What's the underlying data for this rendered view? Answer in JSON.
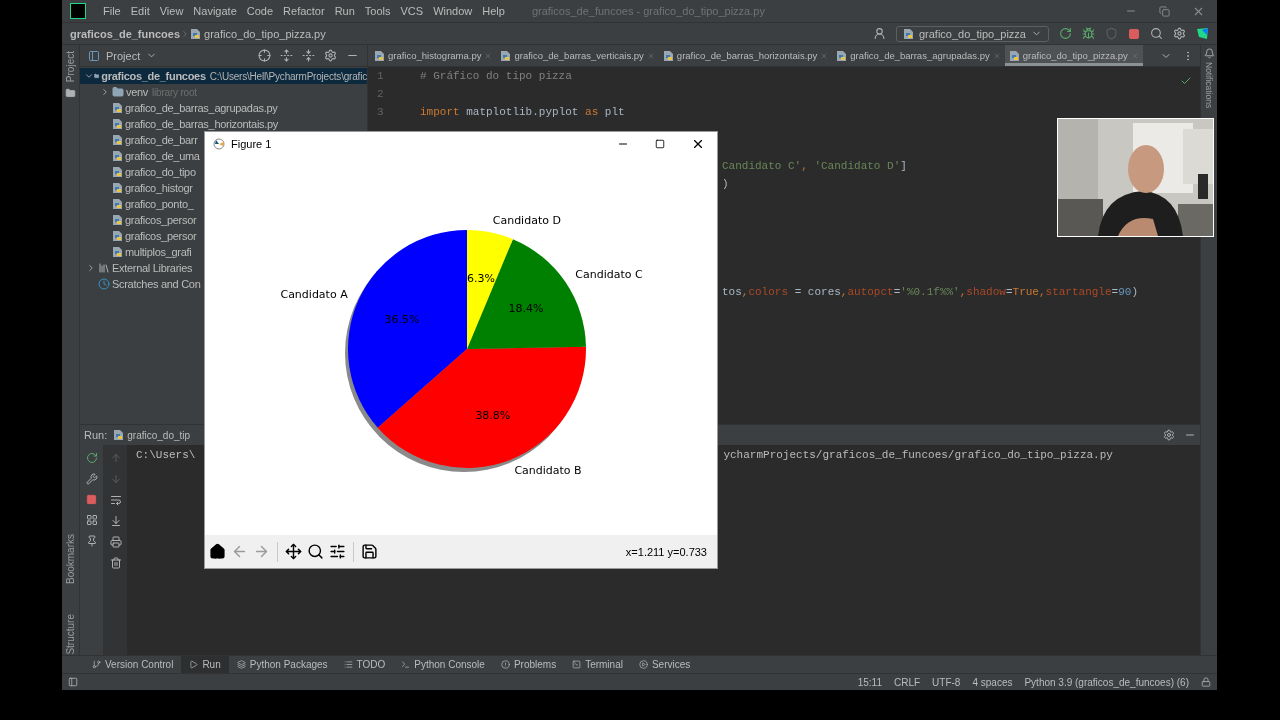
{
  "menu_bar": {
    "items": [
      "File",
      "Edit",
      "View",
      "Navigate",
      "Code",
      "Refactor",
      "Run",
      "Tools",
      "VCS",
      "Window",
      "Help"
    ],
    "title": "graficos_de_funcoes - grafico_do_tipo_pizza.py"
  },
  "nav_bar": {
    "breadcrumb": [
      "graficos_de_funcoes",
      "grafico_do_tipo_pizza.py"
    ],
    "run_config": "grafico_do_tipo_pizza"
  },
  "left_strip": [
    "Project",
    "Bookmarks",
    "Structure"
  ],
  "right_strip": "Notifications",
  "project_panel": {
    "title": "Project",
    "tree": [
      {
        "label": "graficos_de_funcoes",
        "path": "C:\\Users\\Hell\\PycharmProjects\\grafic",
        "kind": "folder",
        "expanded": true,
        "selected": true,
        "children": [
          {
            "label": "venv",
            "note": "library root",
            "kind": "folder",
            "expanded": false,
            "selected": false
          },
          {
            "label": "grafico_de_barras_agrupadas.py",
            "kind": "file",
            "selected": false
          },
          {
            "label": "grafico_de_barras_horizontais.py",
            "kind": "file",
            "selected": false
          },
          {
            "label": "grafico_de_barr",
            "kind": "file",
            "selected": false
          },
          {
            "label": "grafico_de_uma",
            "kind": "file",
            "selected": false
          },
          {
            "label": "grafico_do_tipo",
            "kind": "file",
            "selected": false
          },
          {
            "label": "grafico_histogr",
            "kind": "file",
            "selected": false
          },
          {
            "label": "grafico_ponto_",
            "kind": "file",
            "selected": false
          },
          {
            "label": "graficos_persor",
            "kind": "file",
            "selected": false
          },
          {
            "label": "graficos_persor",
            "kind": "file",
            "selected": false
          },
          {
            "label": "multiplos_grafi",
            "kind": "file",
            "selected": false
          }
        ]
      },
      {
        "label": "External Libraries",
        "kind": "libraries",
        "expanded": false,
        "selected": false
      },
      {
        "label": "Scratches and Con",
        "kind": "scratches",
        "selected": false
      }
    ]
  },
  "editor": {
    "tabs": [
      {
        "label": "grafico_histograma.py",
        "selected": false
      },
      {
        "label": "grafico_de_barras_verticais.py",
        "selected": false
      },
      {
        "label": "grafico_de_barras_horizontais.py",
        "selected": false
      },
      {
        "label": "grafico_de_barras_agrupadas.py",
        "selected": false
      },
      {
        "label": "grafico_do_tipo_pizza.py",
        "selected": true
      }
    ],
    "lines": [
      {
        "number": "1",
        "tokens": [
          {
            "kind": "comment",
            "text": "# Gráfico do tipo pizza"
          }
        ]
      },
      {
        "number": "2"
      },
      {
        "number": "3",
        "tokens": [
          {
            "kind": "keyword",
            "text": "import"
          },
          {
            "kind": "plain",
            "text": " matplotlib.pyplot "
          },
          {
            "kind": "keyword",
            "text": "as"
          },
          {
            "kind": "plain",
            "text": " plt"
          }
        ]
      }
    ],
    "fragments": [
      {
        "tokens": [
          {
            "kind": "string",
            "text": "Candidato C'"
          },
          {
            "kind": "keyword",
            "text": ", "
          },
          {
            "kind": "string",
            "text": "'Candidato D'"
          },
          {
            "kind": "plain",
            "text": "]"
          }
        ]
      },
      {
        "tokens": [
          {
            "kind": "plain",
            "text": ")"
          }
        ]
      },
      {
        "tokens": [
          {
            "kind": "plain",
            "text": "tos"
          },
          {
            "kind": "keyword",
            "text": ","
          },
          {
            "kind": "param",
            "text": "colors"
          },
          {
            "kind": "plain",
            "text": " = cores"
          },
          {
            "kind": "keyword",
            "text": ","
          },
          {
            "kind": "param",
            "text": "autopct"
          },
          {
            "kind": "plain",
            "text": "="
          },
          {
            "kind": "string",
            "text": "'%0.1f%%'"
          },
          {
            "kind": "keyword",
            "text": ","
          },
          {
            "kind": "param",
            "text": "shadow"
          },
          {
            "kind": "plain",
            "text": "="
          },
          {
            "kind": "keyword",
            "text": "True"
          },
          {
            "kind": "keyword",
            "text": ","
          },
          {
            "kind": "param",
            "text": "startangle"
          },
          {
            "kind": "plain",
            "text": "="
          },
          {
            "kind": "number",
            "text": "90"
          },
          {
            "kind": "plain",
            "text": ")"
          }
        ]
      }
    ]
  },
  "run_panel": {
    "label": "Run:",
    "tab": "grafico_do_tip",
    "output": [
      {
        "left": "C:\\Users\\",
        "right": "ycharmProjects/graficos_de_funcoes/grafico_do_tipo_pizza.py"
      }
    ]
  },
  "figure_window": {
    "title": "Figure 1",
    "coordinates": "x=1.211 y=0.733",
    "chart_data": {
      "type": "pie",
      "categories": [
        "Candidato A",
        "Candidato B",
        "Candidato C",
        "Candidato D"
      ],
      "values": [
        36.5,
        38.8,
        18.4,
        6.3
      ],
      "colors": [
        "#0000ff",
        "#ff0000",
        "#008000",
        "#ffff00"
      ],
      "value_labels": [
        "36.5%",
        "38.8%",
        "18.4%",
        "6.3%"
      ]
    }
  },
  "webcam": {
    "kind": "picture"
  },
  "tool_windows": [
    {
      "label": "Version Control",
      "selected": false
    },
    {
      "label": "Run",
      "selected": true
    },
    {
      "label": "Python Packages",
      "selected": false
    },
    {
      "label": "TODO",
      "selected": false
    },
    {
      "label": "Python Console",
      "selected": false
    },
    {
      "label": "Problems",
      "selected": false
    },
    {
      "label": "Terminal",
      "selected": false
    },
    {
      "label": "Services",
      "selected": false
    }
  ],
  "status_bar": [
    "15:11",
    "CRLF",
    "UTF-8",
    "4 spaces",
    "Python 3.9 (graficos_de_funcoes) (6)"
  ]
}
